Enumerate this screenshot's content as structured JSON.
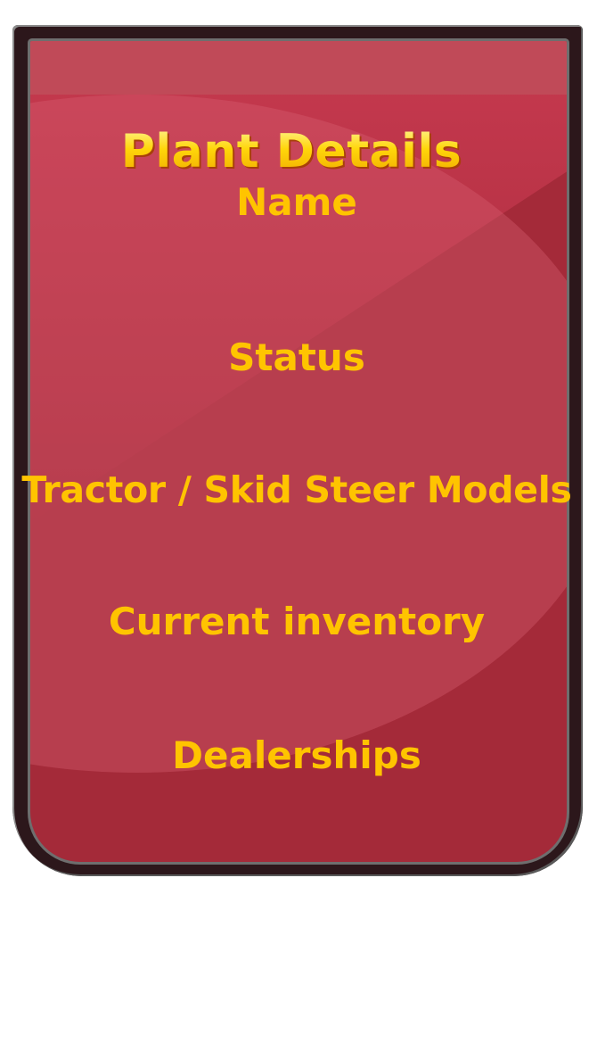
{
  "card": {
    "title": "Plant Details",
    "fields": [
      {
        "label": "Name"
      },
      {
        "label": "Status"
      },
      {
        "label": "Tractor / Skid Steer Models"
      },
      {
        "label": "Current inventory"
      },
      {
        "label": "Dealerships"
      }
    ]
  },
  "colors": {
    "card_fill": "#a42a39",
    "card_gloss": "#c04a58",
    "frame": "#2c171b",
    "text_gold": "#ffc400"
  }
}
